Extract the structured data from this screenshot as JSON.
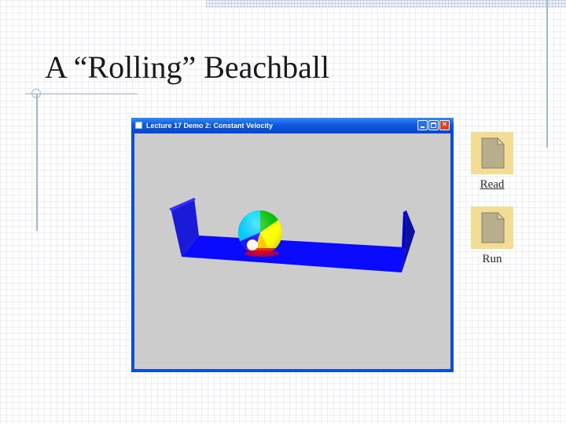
{
  "slide": {
    "title": "A “Rolling” Beachball"
  },
  "app_window": {
    "title": "Lecture 17 Demo 2: Constant Velocity",
    "buttons": [
      "minimize",
      "maximize",
      "close"
    ],
    "canvas_background": "#cccccc",
    "track_color": "#0000ff",
    "ball_colors": [
      "#00c8ff",
      "#00c000",
      "#ffff00",
      "#ff0000",
      "#ffffff",
      "#0000cc"
    ]
  },
  "links": [
    {
      "label": "Read",
      "icon": "document-icon"
    },
    {
      "label": "Run",
      "icon": "document-icon"
    }
  ],
  "colors": {
    "window_frame": "#0b4fd6",
    "guide_lines": "#a9b6cc",
    "icon_tile": "#f1dd95"
  }
}
